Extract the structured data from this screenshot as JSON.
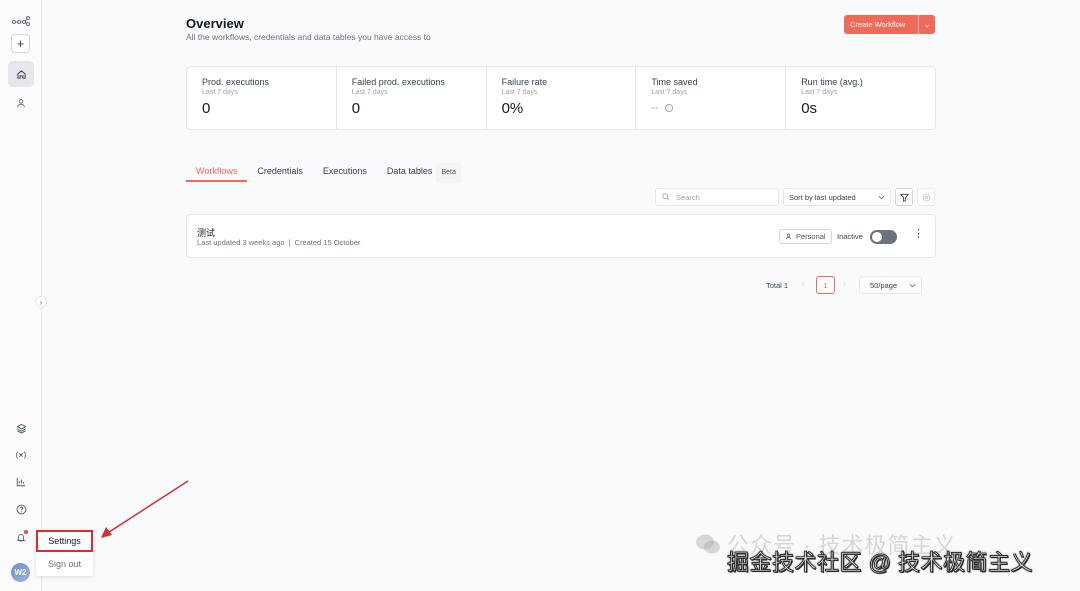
{
  "sidebar": {
    "add_label": "+",
    "collapse_label": "›",
    "avatar_initials": "W2"
  },
  "user_menu": {
    "settings_label": "Settings",
    "signout_label": "Sign out"
  },
  "header": {
    "title": "Overview",
    "subtitle": "All the workflows, credentials and data tables you have access to",
    "create_label": "Create Workflow",
    "create_caret": "⌄"
  },
  "stats": [
    {
      "label": "Prod. executions",
      "period": "Last 7 days",
      "value": "0"
    },
    {
      "label": "Failed prod. executions",
      "period": "Last 7 days",
      "value": "0"
    },
    {
      "label": "Failure rate",
      "period": "Last 7 days",
      "value": "0%"
    },
    {
      "label": "Time saved",
      "period": "Last 7 days",
      "value": "--"
    },
    {
      "label": "Run time (avg.)",
      "period": "Last 7 days",
      "value": "0s"
    }
  ],
  "tabs": [
    {
      "label": "Workflows",
      "active": true
    },
    {
      "label": "Credentials"
    },
    {
      "label": "Executions"
    },
    {
      "label": "Data tables",
      "badge": "Beta"
    }
  ],
  "toolbar": {
    "search_placeholder": "Search",
    "sort_value": "Sort by last updated"
  },
  "workflow": {
    "name": "测试",
    "updated": "Last updated 3 weeks ago",
    "separator": "|",
    "created": "Created 15 October",
    "owner": "Personal",
    "status": "Inactive",
    "more": "⋮"
  },
  "pagination": {
    "total": "Total 1",
    "page": "1",
    "per_page": "50/page",
    "prev": "‹",
    "next": "›"
  },
  "watermark": {
    "line1": "公众号 · 技术极简主义",
    "line2": "掘金技术社区 @ 技术极简主义"
  },
  "colors": {
    "accent": "#ef6a59",
    "annotation": "#d32f2f"
  }
}
